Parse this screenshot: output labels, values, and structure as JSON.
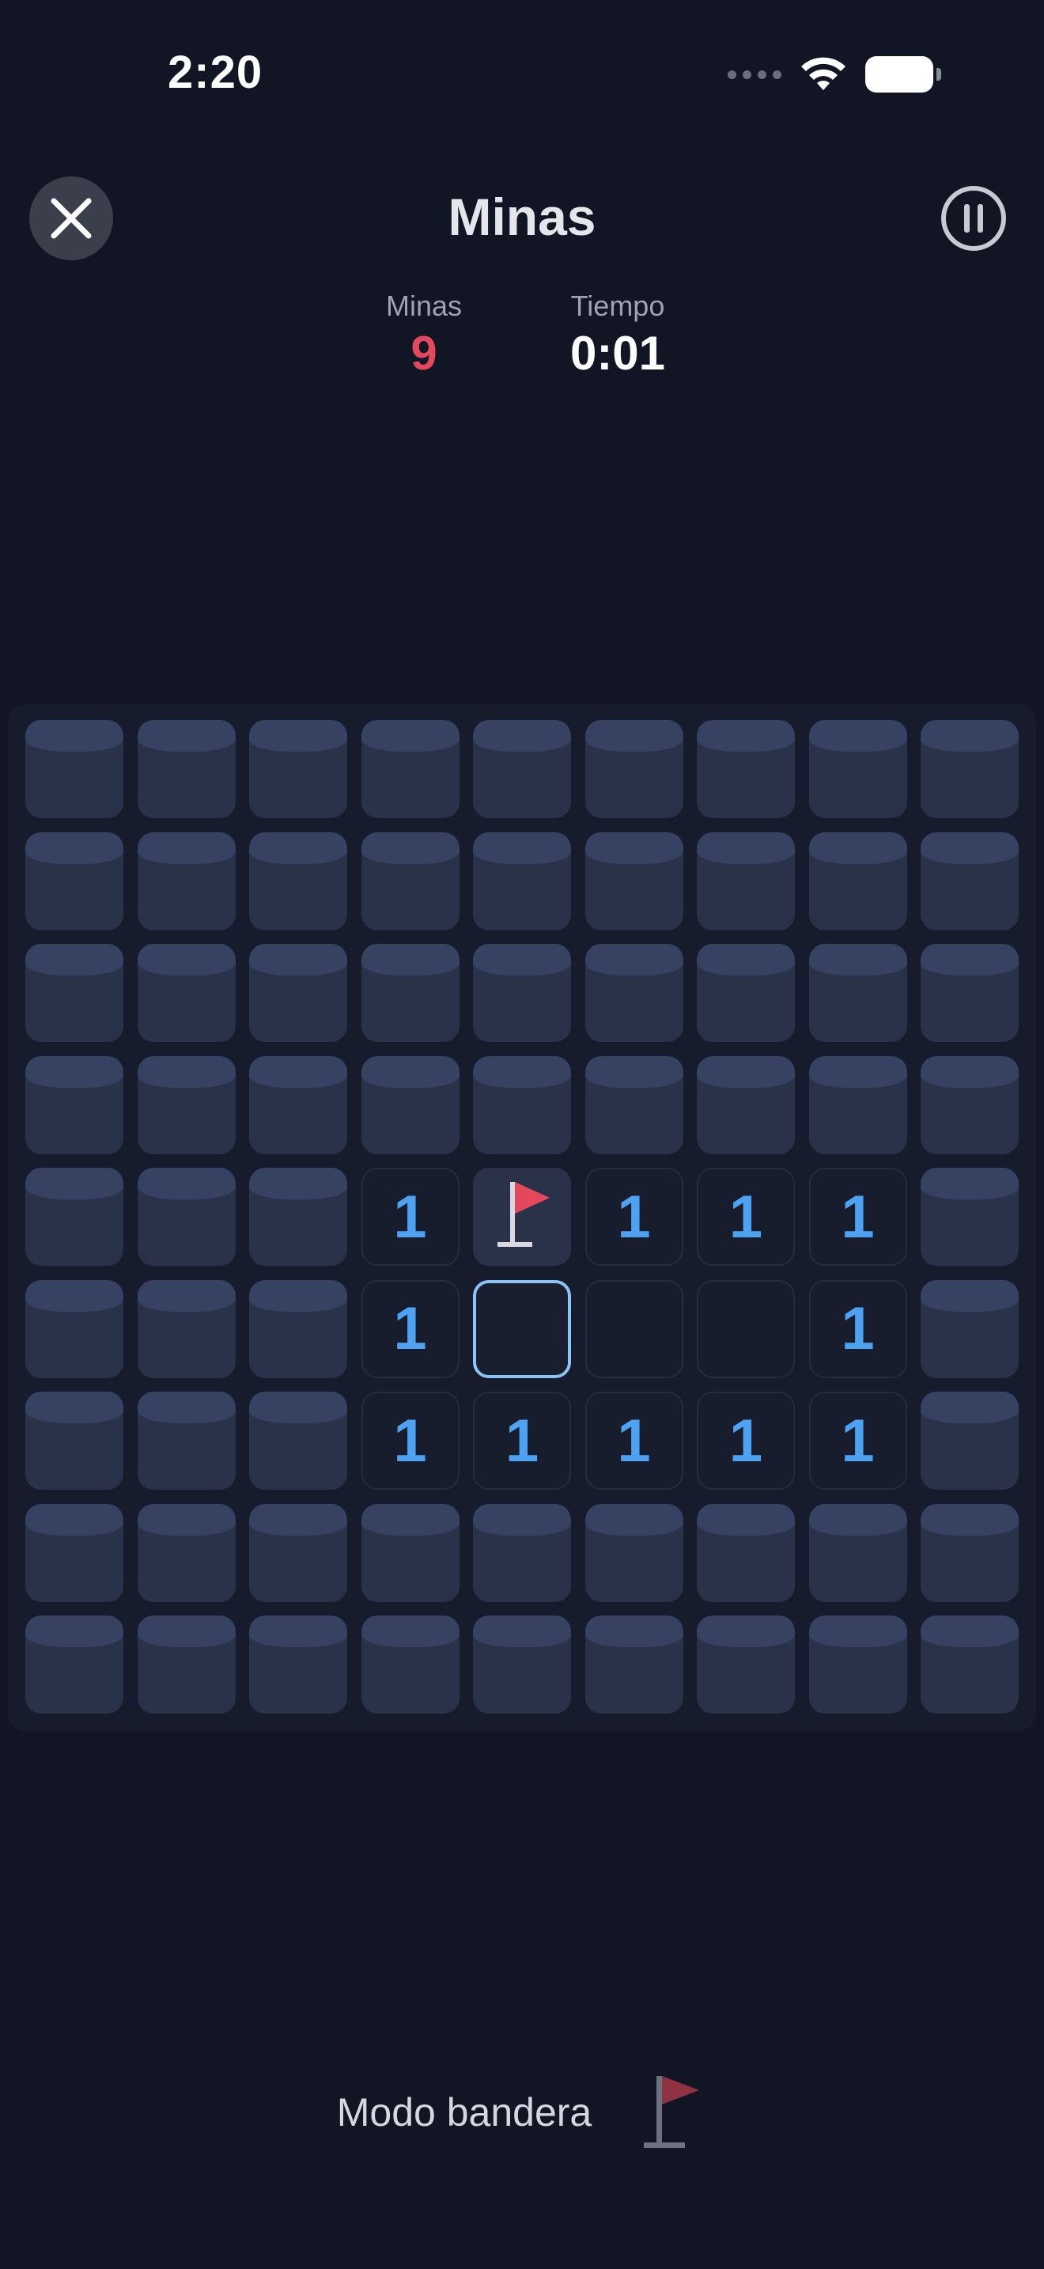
{
  "status_bar": {
    "time": "2:20"
  },
  "header": {
    "title": "Minas",
    "close_icon": "close-icon",
    "pause_icon": "pause-icon"
  },
  "stats": {
    "mines_label": "Minas",
    "mines_value": "9",
    "time_label": "Tiempo",
    "time_value": "0:01"
  },
  "colors": {
    "background": "#111524",
    "mines_value": "#e5485d",
    "number": "#4da2f2",
    "flag": "#e5485d",
    "selected_border": "#8cc4f5"
  },
  "board": {
    "rows": [
      [
        "H",
        "H",
        "H",
        "H",
        "H",
        "H",
        "H",
        "H",
        "H"
      ],
      [
        "H",
        "H",
        "H",
        "H",
        "H",
        "H",
        "H",
        "H",
        "H"
      ],
      [
        "H",
        "H",
        "H",
        "H",
        "H",
        "H",
        "H",
        "H",
        "H"
      ],
      [
        "H",
        "H",
        "H",
        "H",
        "H",
        "H",
        "H",
        "H",
        "H"
      ],
      [
        "H",
        "H",
        "H",
        "1",
        "F",
        "1",
        "1",
        "1",
        "H"
      ],
      [
        "H",
        "H",
        "H",
        "1",
        "S",
        "0",
        "0",
        "1",
        "H"
      ],
      [
        "H",
        "H",
        "H",
        "1",
        "1",
        "1",
        "1",
        "1",
        "H"
      ],
      [
        "H",
        "H",
        "H",
        "H",
        "H",
        "H",
        "H",
        "H",
        "H"
      ],
      [
        "H",
        "H",
        "H",
        "H",
        "H",
        "H",
        "H",
        "H",
        "H"
      ]
    ]
  },
  "footer": {
    "flag_mode_label": "Modo bandera",
    "flag_mode_icon": "flag-icon"
  }
}
